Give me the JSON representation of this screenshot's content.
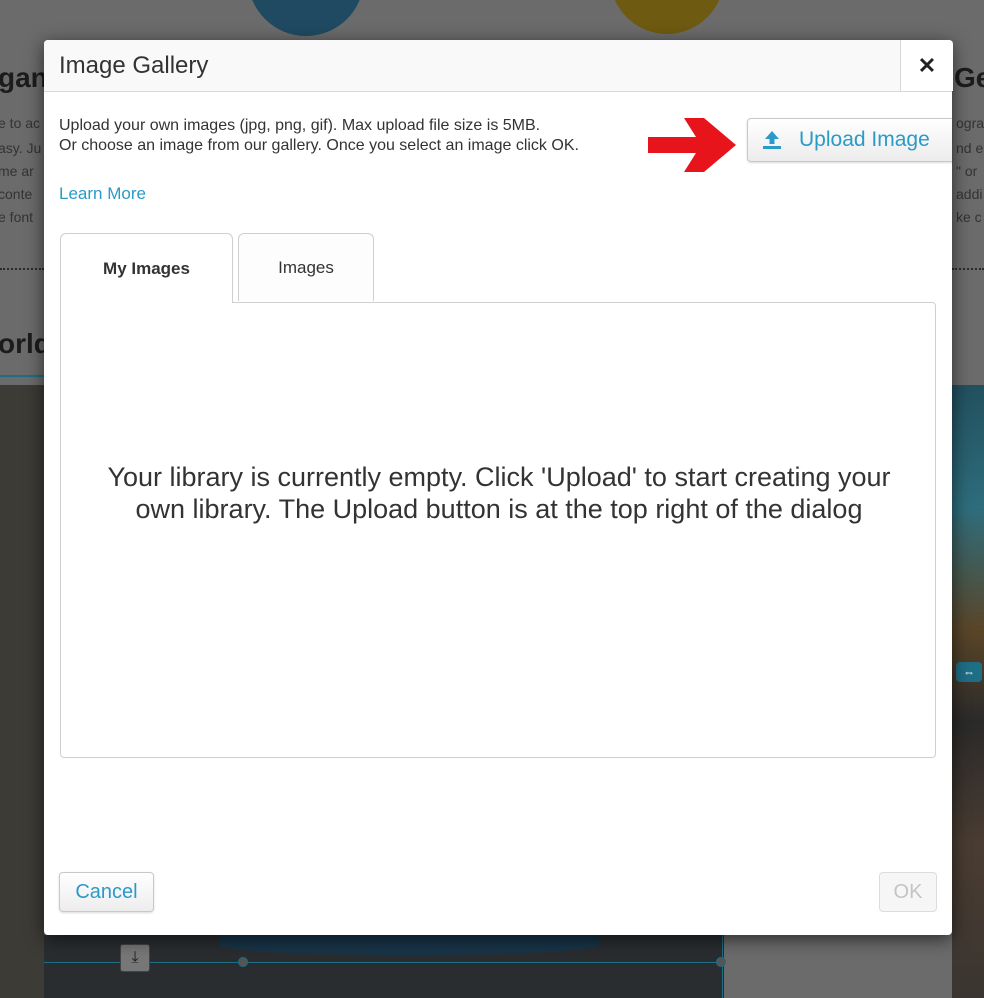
{
  "background": {
    "heading_left": "gan",
    "heading_left2": "orld",
    "heading_right": "Ge",
    "text_left": [
      "e to ac",
      "asy. Ju",
      "me ar",
      "conte",
      "e font"
    ],
    "text_right": [
      "ograp",
      "nd e",
      "\" or",
      "addi",
      "ke c"
    ]
  },
  "dialog": {
    "title": "Image Gallery",
    "close_glyph": "✕",
    "description_line1": "Upload your own images (jpg, png, gif). Max upload file size is 5MB.",
    "description_line2": "Or choose an image from our gallery. Once you select an image click OK.",
    "learn_more": "Learn More",
    "upload_button": "Upload Image",
    "tabs": [
      {
        "label": "My Images",
        "active": true
      },
      {
        "label": "Images",
        "active": false
      }
    ],
    "empty_message": "Your library is currently empty. Click 'Upload' to start creating your own library. The Upload button is at the top right of the dialog",
    "cancel_button": "Cancel",
    "ok_button": "OK"
  },
  "colors": {
    "accent": "#2a9ac8",
    "arrow": "#e8141b",
    "overlay": "#6b6b6b"
  },
  "icons": {
    "upload": "upload-icon",
    "close": "close-icon",
    "arrow": "red-arrow-icon",
    "download": "download-icon"
  }
}
